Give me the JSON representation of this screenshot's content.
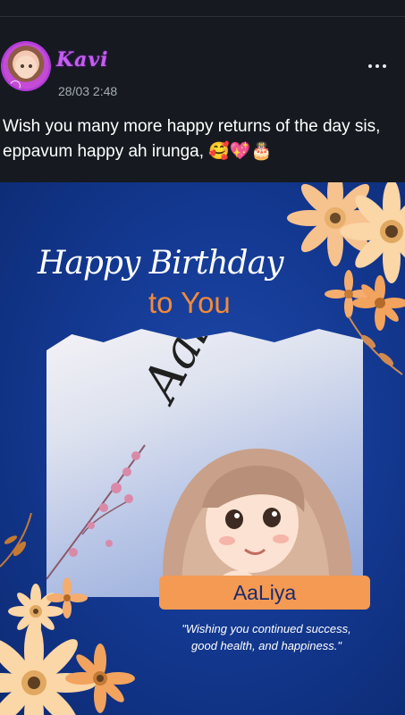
{
  "post": {
    "username": "Kavi",
    "timestamp": "28/03 2:48",
    "caption": "Wish you many more happy returns of the day sis, eppavum happy ah irunga, 🥰💖🎂"
  },
  "card": {
    "title": "Happy Birthday",
    "subtitle": "to You",
    "script_name": "Aaliya",
    "name_banner": "AaLiya",
    "wish_line1": "\"Wishing you continued success,",
    "wish_line2": "good health, and happiness.\""
  },
  "colors": {
    "background": "#161a20",
    "username": "#c45ef0",
    "card_blue": "#143a94",
    "accent_orange": "#f28a3a",
    "banner": "#f49a52"
  },
  "icons": [
    "more-options-icon"
  ]
}
